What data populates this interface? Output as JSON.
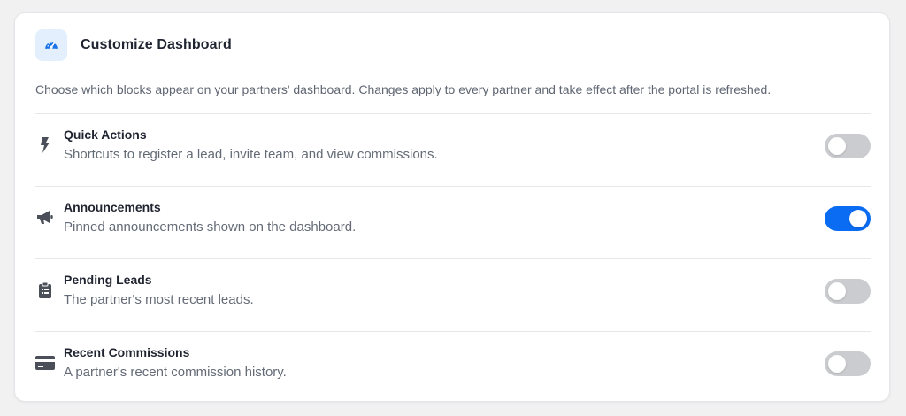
{
  "header": {
    "icon": "gauge-icon",
    "title": "Customize Dashboard"
  },
  "description": "Choose which blocks appear on your partners' dashboard. Changes apply to every partner and take effect after the portal is refreshed.",
  "blocks": [
    {
      "icon": "lightning-icon",
      "title": "Quick Actions",
      "description": "Shortcuts to register a lead, invite team, and view commissions.",
      "enabled": false
    },
    {
      "icon": "megaphone-icon",
      "title": "Announcements",
      "description": "Pinned announcements shown on the dashboard.",
      "enabled": true
    },
    {
      "icon": "clipboard-icon",
      "title": "Pending Leads",
      "description": "The partner's most recent leads.",
      "enabled": false
    },
    {
      "icon": "credit-card-icon",
      "title": "Recent Commissions",
      "description": "A partner's recent commission history.",
      "enabled": false
    }
  ],
  "colors": {
    "accent": "#0a6cf2",
    "toggle_off": "#cbcccf",
    "icon_tile": "#e3effd"
  }
}
